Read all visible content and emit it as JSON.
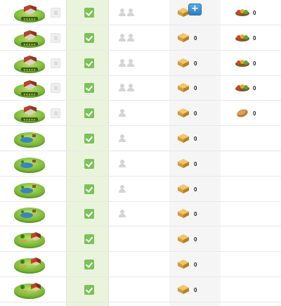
{
  "add_button": {
    "label": "+"
  },
  "colors": {
    "check": "#7cc15a",
    "green_column": "#eaf4dd",
    "plus_button": "#2f7fc0"
  },
  "rows": [
    {
      "building": "house-level-icon",
      "stars": true,
      "locked": true,
      "checked": true,
      "workers": 2,
      "goods": "",
      "food": "0",
      "food_type": "vegetables-icon"
    },
    {
      "building": "house-level-icon",
      "stars": true,
      "locked": true,
      "checked": true,
      "workers": 2,
      "goods": "0",
      "food": "0",
      "food_type": "vegetables-icon"
    },
    {
      "building": "house-level-icon",
      "stars": true,
      "locked": true,
      "checked": true,
      "workers": 2,
      "goods": "0",
      "food": "0",
      "food_type": "vegetables-icon"
    },
    {
      "building": "house-level-icon",
      "stars": true,
      "locked": true,
      "checked": true,
      "workers": 2,
      "goods": "0",
      "food": "0",
      "food_type": "vegetables-icon"
    },
    {
      "building": "house-level-icon",
      "stars": true,
      "locked": true,
      "checked": true,
      "workers": 1,
      "goods": "0",
      "food": "0",
      "food_type": "bread-icon"
    },
    {
      "building": "pond-icon",
      "stars": false,
      "locked": false,
      "checked": true,
      "workers": 1,
      "goods": "0",
      "food": "",
      "food_type": ""
    },
    {
      "building": "pond-icon",
      "stars": false,
      "locked": false,
      "checked": true,
      "workers": 1,
      "goods": "0",
      "food": "",
      "food_type": ""
    },
    {
      "building": "pond-icon",
      "stars": false,
      "locked": false,
      "checked": true,
      "workers": 1,
      "goods": "0",
      "food": "",
      "food_type": ""
    },
    {
      "building": "pond-icon",
      "stars": false,
      "locked": false,
      "checked": true,
      "workers": 1,
      "goods": "0",
      "food": "",
      "food_type": ""
    },
    {
      "building": "farm-icon",
      "stars": false,
      "locked": false,
      "checked": true,
      "workers": 0,
      "goods": "0",
      "food": "",
      "food_type": ""
    },
    {
      "building": "farm-icon",
      "stars": false,
      "locked": false,
      "checked": true,
      "workers": 0,
      "goods": "0",
      "food": "",
      "food_type": ""
    },
    {
      "building": "farm-icon",
      "stars": false,
      "locked": false,
      "checked": true,
      "workers": 0,
      "goods": "0",
      "food": "",
      "food_type": ""
    }
  ]
}
